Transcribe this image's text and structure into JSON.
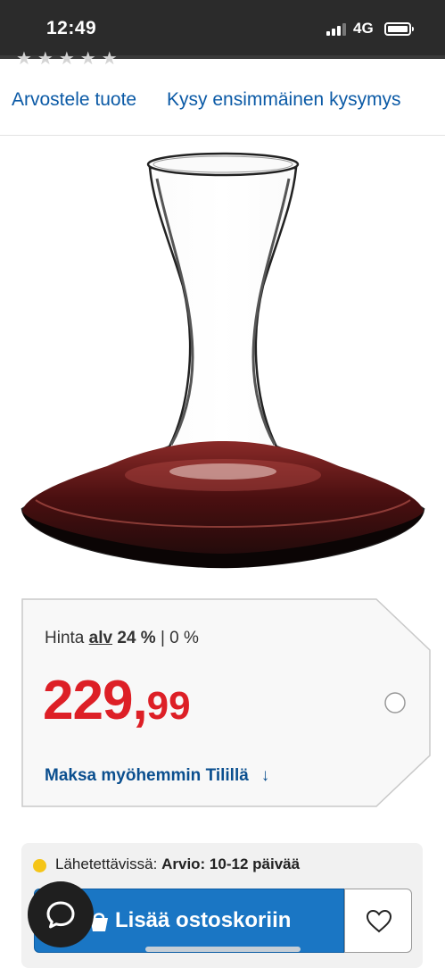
{
  "status_bar": {
    "time": "12:49",
    "network": "4G",
    "icons": [
      "signal-icon",
      "battery-icon"
    ]
  },
  "rating": {
    "stars": "★★★★★"
  },
  "review_links": {
    "review": "Arvostele tuote",
    "question": "Kysy ensimmäinen kysymys"
  },
  "product": {
    "image_icon": "decanter-image"
  },
  "price": {
    "label_prefix": "Hinta",
    "alv": "alv",
    "vat_rate": "24 %",
    "separator": "|",
    "vat_zero": "0 %",
    "whole": "229,",
    "cents": "99",
    "pay_later": "Maksa myöhemmin Tilillä",
    "pay_later_arrow": "↓"
  },
  "delivery": {
    "status_label": "Lähetettävissä:",
    "estimate": "Arvio: 10-12 päivää"
  },
  "actions": {
    "add_to_cart": "Lisää ostoskoriin",
    "wishlist_icon": "heart-icon",
    "chat_icon": "chat-icon"
  },
  "colors": {
    "price": "#dd1f26",
    "link": "#0b5aa6",
    "button": "#1a76c4",
    "availability_dot": "#f5c518"
  }
}
